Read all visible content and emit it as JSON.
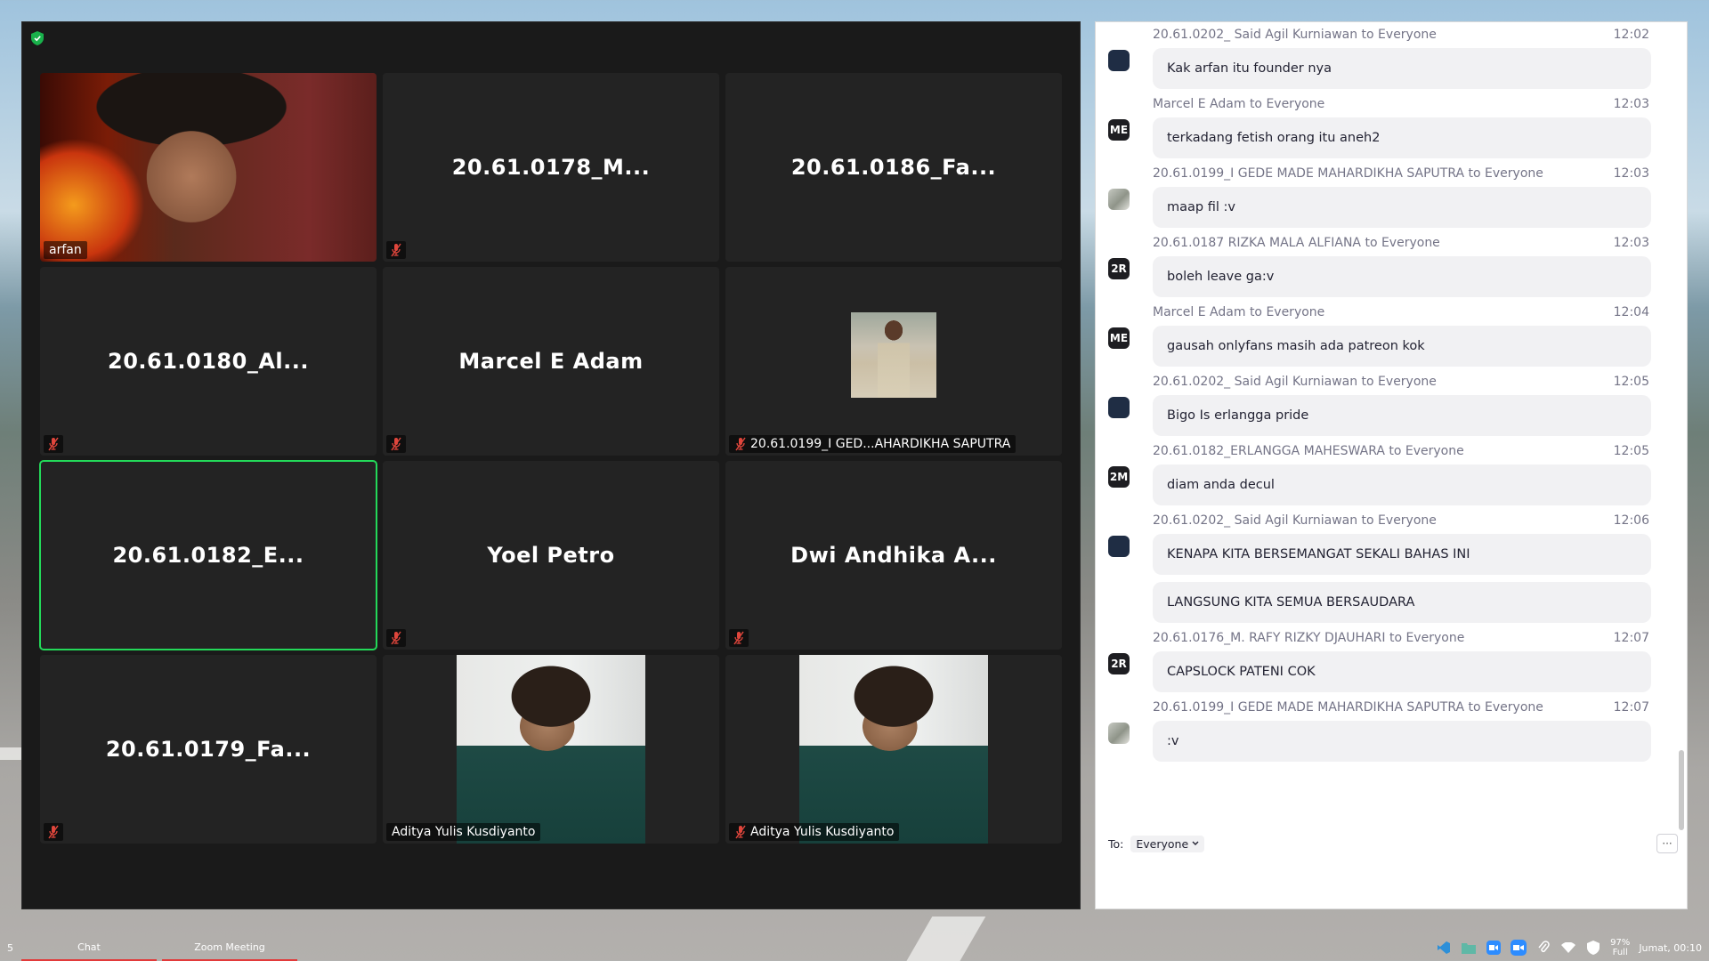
{
  "meeting": {
    "tiles": [
      {
        "name": "arfan",
        "type": "video",
        "caption": "arfan",
        "muted": false,
        "active": false
      },
      {
        "name": "20.61.0178_M...",
        "type": "name",
        "muted": true,
        "active": false
      },
      {
        "name": "20.61.0186_Fa...",
        "type": "name",
        "muted": false,
        "active": false
      },
      {
        "name": "20.61.0180_Al...",
        "type": "name",
        "muted": true,
        "active": false
      },
      {
        "name": "Marcel E Adam",
        "type": "name",
        "muted": true,
        "active": false
      },
      {
        "name": "20.61.0199_I GED...AHARDIKHA SAPUTRA",
        "type": "thumb",
        "caption": "20.61.0199_I GED...AHARDIKHA SAPUTRA",
        "muted": true,
        "active": false
      },
      {
        "name": "20.61.0182_E...",
        "type": "name",
        "muted": false,
        "active": true
      },
      {
        "name": "Yoel Petro",
        "type": "name",
        "muted": true,
        "active": false
      },
      {
        "name": "Dwi Andhika A...",
        "type": "name",
        "muted": true,
        "active": false
      },
      {
        "name": "20.61.0179_Fa...",
        "type": "name",
        "muted": true,
        "active": false
      },
      {
        "name": "Aditya Yulis Kusdiyanto",
        "type": "video2",
        "caption": "Aditya Yulis Kusdiyanto",
        "muted": false,
        "active": false
      },
      {
        "name": "Aditya Yulis Kusdiyanto",
        "type": "video2",
        "caption": "Aditya Yulis Kusdiyanto",
        "muted": true,
        "active": false
      }
    ]
  },
  "chat": {
    "messages": [
      {
        "sender": "20.61.0202_ Said Agil Kurniawan to Everyone",
        "time": "12:02",
        "avatar": "",
        "avatar_style": "navy",
        "texts": [
          "Kak arfan itu founder nya"
        ]
      },
      {
        "sender": "Marcel E Adam to Everyone",
        "time": "12:03",
        "avatar": "ME",
        "avatar_style": "dark",
        "texts": [
          "terkadang fetish orang itu aneh2"
        ]
      },
      {
        "sender": "20.61.0199_I GEDE MADE MAHARDIKHA SAPUTRA to Everyone",
        "time": "12:03",
        "avatar": "",
        "avatar_style": "photo",
        "texts": [
          "maap fil :v"
        ]
      },
      {
        "sender": "20.61.0187 RIZKA MALA ALFIANA to Everyone",
        "time": "12:03",
        "avatar": "2R",
        "avatar_style": "dark",
        "texts": [
          "boleh leave ga:v"
        ]
      },
      {
        "sender": "Marcel E Adam to Everyone",
        "time": "12:04",
        "avatar": "ME",
        "avatar_style": "dark",
        "texts": [
          "gausah onlyfans masih ada patreon kok"
        ]
      },
      {
        "sender": "20.61.0202_ Said Agil Kurniawan to Everyone",
        "time": "12:05",
        "avatar": "",
        "avatar_style": "navy",
        "texts": [
          "Bigo Is erlangga pride"
        ]
      },
      {
        "sender": "20.61.0182_ERLANGGA MAHESWARA to Everyone",
        "time": "12:05",
        "avatar": "2M",
        "avatar_style": "dark",
        "texts": [
          "diam anda decul"
        ]
      },
      {
        "sender": "20.61.0202_ Said Agil Kurniawan to Everyone",
        "time": "12:06",
        "avatar": "",
        "avatar_style": "navy",
        "texts": [
          "KENAPA KITA BERSEMANGAT SEKALI BAHAS INI",
          "LANGSUNG KITA SEMUA BERSAUDARA"
        ]
      },
      {
        "sender": "20.61.0176_M. RAFY RIZKY DJAUHARI to Everyone",
        "time": "12:07",
        "avatar": "2R",
        "avatar_style": "dark",
        "texts": [
          "CAPSLOCK PATENI COK"
        ]
      },
      {
        "sender": "20.61.0199_I GEDE MADE MAHARDIKHA SAPUTRA to Everyone",
        "time": "12:07",
        "avatar": "",
        "avatar_style": "photo",
        "texts": [
          ":v"
        ]
      }
    ],
    "to_label": "To:",
    "to_value": "Everyone",
    "more_label": "···"
  },
  "taskbar": {
    "workspace": "5",
    "items": [
      "Chat",
      "Zoom Meeting"
    ],
    "battery_percent": "97%",
    "battery_state": "Full",
    "clock": "Jumat, 00:10"
  },
  "colors": {
    "active_speaker": "#23d959",
    "muted_icon": "#e0463c",
    "taskbar_underline": "#e23a3a"
  }
}
